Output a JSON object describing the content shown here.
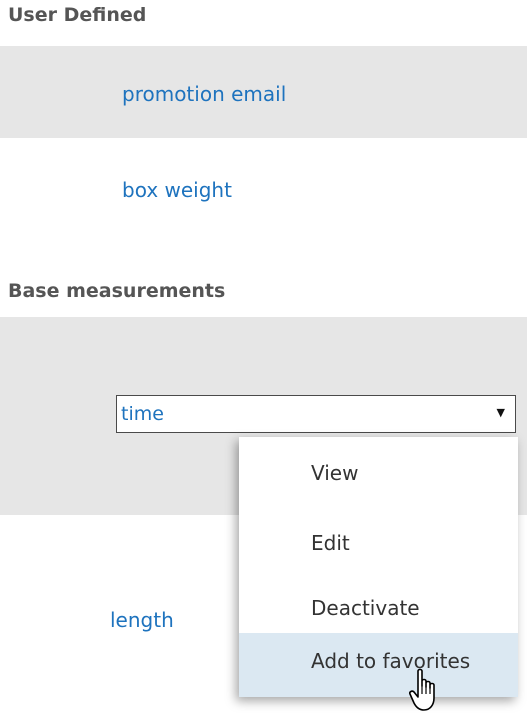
{
  "sections": {
    "user_defined": {
      "title": "User Defined",
      "items": [
        "promotion email",
        "box weight"
      ]
    },
    "base_measurements": {
      "title": "Base measurements",
      "select": {
        "value": "time"
      },
      "items": [
        "length"
      ]
    }
  },
  "context_menu": {
    "items": [
      "View",
      "Edit",
      "Deactivate",
      "Add to favorites"
    ],
    "highlighted": "Add to favorites"
  },
  "colors": {
    "link": "#1e73be",
    "row_shade": "#e6e6e6",
    "menu_highlight": "#dbe8f2"
  },
  "icons": {
    "caret": "dropdown-caret-icon",
    "cursor": "hand-pointer-cursor-icon"
  }
}
